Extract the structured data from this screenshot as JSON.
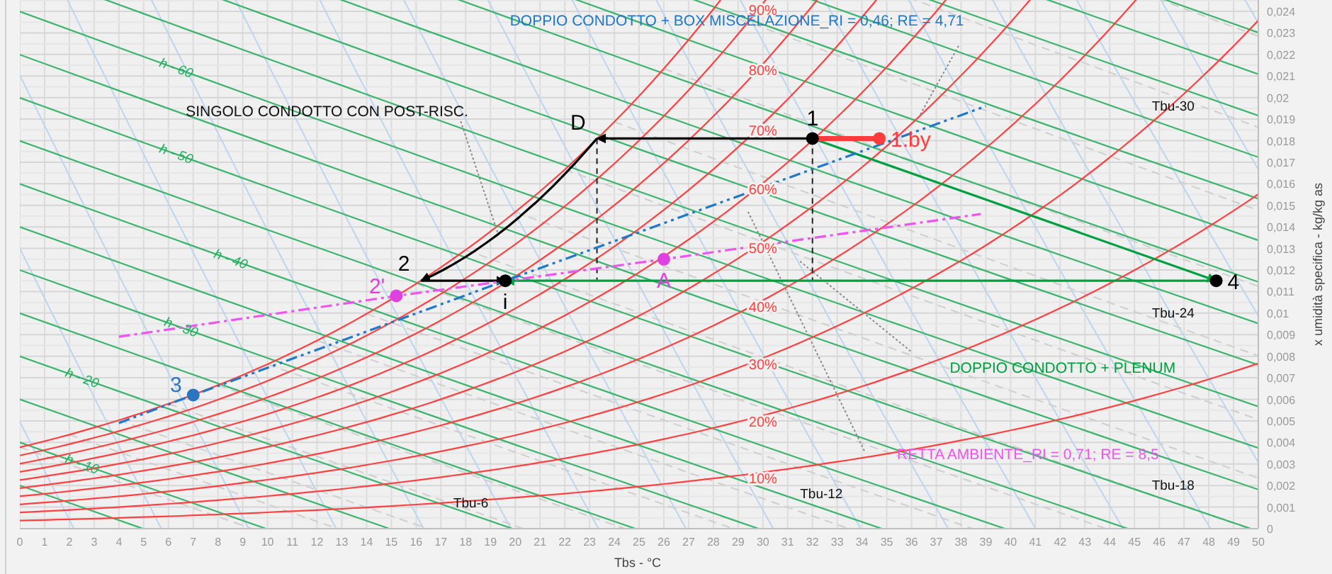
{
  "chart_labels": {
    "notes": [
      "DOPPIO CONDOTTO + BOX MISCELAZIONE_RI = 0,46; RE = 4,71",
      "SINGOLO CONDOTTO CON POST-RISC.",
      "DOPPIO CONDOTTO + PLENUM",
      "RETTA AMBIENTE_RI = 0,71; RE = 8,5"
    ],
    "enthalpy_labels": [
      "h - 60",
      "h - 50",
      "h - 40",
      "h - 30",
      "h - 20",
      "h - 10"
    ],
    "wet_bulb_labels": [
      "Tbu-30",
      "Tbu-24",
      "Tbu-18",
      "Tbu-12",
      "Tbu-6"
    ],
    "humidity_labels": [
      "90%",
      "80%",
      "70%",
      "60%",
      "50%",
      "40%",
      "30%",
      "20%",
      "10%"
    ]
  },
  "chart_data": {
    "type": "line",
    "xlabel": "Tbs - °C",
    "ylabel": "x  umidità specifica - kg/kg as",
    "xlim": [
      0,
      50
    ],
    "ylim": [
      0,
      0.0245
    ],
    "grid": true,
    "xticks": [
      0,
      1,
      2,
      3,
      4,
      5,
      6,
      7,
      8,
      9,
      10,
      11,
      12,
      13,
      14,
      15,
      16,
      17,
      18,
      19,
      20,
      21,
      22,
      23,
      24,
      25,
      26,
      27,
      28,
      29,
      30,
      31,
      32,
      33,
      34,
      35,
      36,
      37,
      38,
      39,
      40,
      41,
      42,
      43,
      44,
      45,
      46,
      47,
      48,
      49,
      50
    ],
    "yticks": [
      {
        "value": 0,
        "label": "0"
      },
      {
        "value": 0.001,
        "label": "0,001"
      },
      {
        "value": 0.002,
        "label": "0,002"
      },
      {
        "value": 0.003,
        "label": "0,003"
      },
      {
        "value": 0.004,
        "label": "0,004"
      },
      {
        "value": 0.005,
        "label": "0,005"
      },
      {
        "value": 0.006,
        "label": "0,006"
      },
      {
        "value": 0.007,
        "label": "0,007"
      },
      {
        "value": 0.008,
        "label": "0,008"
      },
      {
        "value": 0.009,
        "label": "0,009"
      },
      {
        "value": 0.01,
        "label": "0,01"
      },
      {
        "value": 0.011,
        "label": "0,011"
      },
      {
        "value": 0.012,
        "label": "0,012"
      },
      {
        "value": 0.013,
        "label": "0,013"
      },
      {
        "value": 0.014,
        "label": "0,014"
      },
      {
        "value": 0.015,
        "label": "0,015"
      },
      {
        "value": 0.016,
        "label": "0,016"
      },
      {
        "value": 0.017,
        "label": "0,017"
      },
      {
        "value": 0.018,
        "label": "0,018"
      },
      {
        "value": 0.019,
        "label": "0,019"
      },
      {
        "value": 0.02,
        "label": "0,02"
      },
      {
        "value": 0.021,
        "label": "0,021"
      },
      {
        "value": 0.022,
        "label": "0,022"
      },
      {
        "value": 0.023,
        "label": "0,023"
      },
      {
        "value": 0.024,
        "label": "0,024"
      }
    ],
    "x": [
      4,
      7,
      15.2,
      16.2,
      19.6,
      20.8,
      23.3,
      26,
      32,
      34.7,
      38.8,
      39,
      48.3
    ],
    "series": [
      {
        "color": "#000000",
        "values": [
          null,
          null,
          null,
          null,
          null,
          null,
          0.0181,
          null,
          0.0181,
          null,
          null,
          null,
          null
        ]
      },
      {
        "color": "#000000",
        "values": [
          null,
          null,
          null,
          0.0115,
          null,
          0.0151,
          0.0181,
          null,
          null,
          null,
          null,
          null,
          null
        ]
      },
      {
        "color": "#000000",
        "values": [
          null,
          null,
          null,
          0.0115,
          0.0115,
          null,
          null,
          null,
          null,
          null,
          null,
          null,
          null
        ]
      },
      {
        "color": "#00a040",
        "values": [
          null,
          null,
          null,
          null,
          null,
          null,
          null,
          null,
          0.0181,
          null,
          null,
          null,
          0.0115
        ]
      },
      {
        "color": "#00a040",
        "values": [
          null,
          null,
          null,
          null,
          0.0115,
          null,
          null,
          null,
          null,
          null,
          null,
          null,
          0.0115
        ]
      },
      {
        "color": "#ff3b3b",
        "values": [
          null,
          null,
          null,
          null,
          null,
          null,
          null,
          null,
          0.0181,
          0.0181,
          null,
          null,
          null
        ]
      },
      {
        "color": "#1f78c8",
        "line_style": "dashdot",
        "values": [
          0.0049,
          0.0062,
          null,
          null,
          0.0115,
          null,
          null,
          null,
          null,
          null,
          null,
          0.0196,
          null
        ]
      },
      {
        "color": "#ee55ee",
        "line_style": "dashdot",
        "values": [
          0.0089,
          null,
          0.0108,
          null,
          null,
          null,
          null,
          0.0125,
          null,
          null,
          0.0146,
          null,
          null
        ]
      }
    ],
    "annotations": [
      {
        "text": "1",
        "x": 32,
        "y": 0.0181
      },
      {
        "text": "1.by",
        "x": 34.7,
        "y": 0.0181
      },
      {
        "text": "D",
        "x": 23.3,
        "y": 0.0181
      },
      {
        "text": "2",
        "x": 16.2,
        "y": 0.0115
      },
      {
        "text": "2'",
        "x": 15.2,
        "y": 0.0108
      },
      {
        "text": "i",
        "x": 19.6,
        "y": 0.0115
      },
      {
        "text": "A",
        "x": 26,
        "y": 0.0125
      },
      {
        "text": "3",
        "x": 7,
        "y": 0.0062
      },
      {
        "text": "4",
        "x": 48.3,
        "y": 0.0115
      }
    ]
  }
}
